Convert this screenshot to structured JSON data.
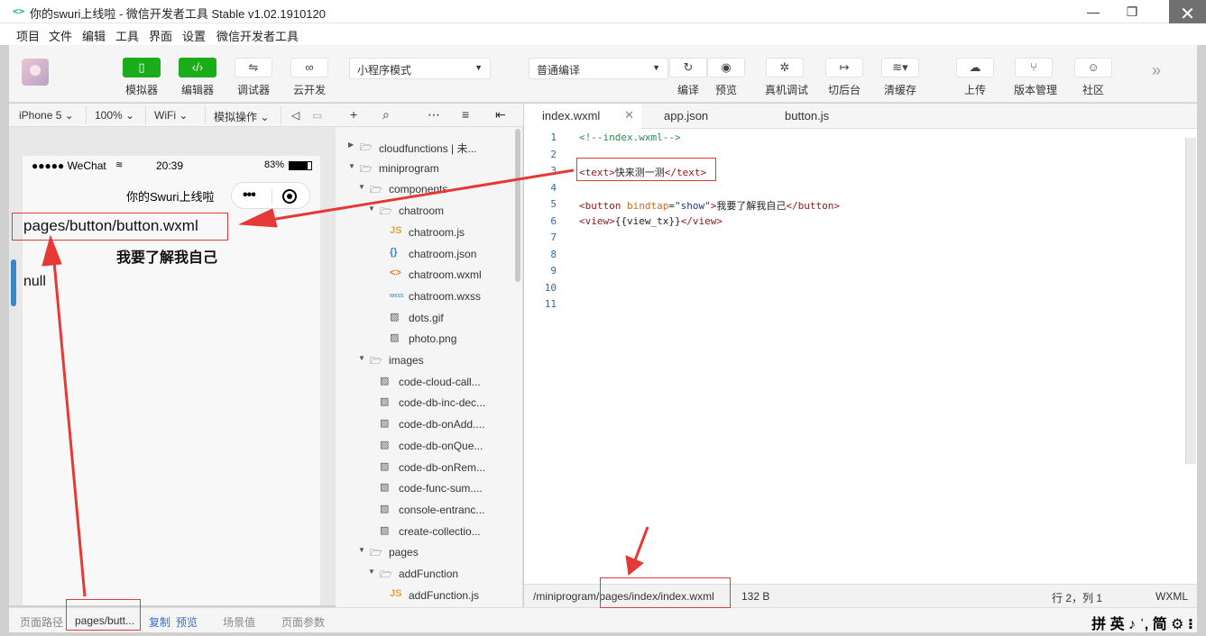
{
  "window": {
    "logo_glyph": "<>",
    "title": "你的swuri上线啦 - 微信开发者工具 Stable v1.02.1910120",
    "minimize_glyph": "—",
    "restore_glyph": "❐",
    "close_glyph": "✕"
  },
  "menu": [
    "项目",
    "文件",
    "编辑",
    "工具",
    "界面",
    "设置",
    "微信开发者工具"
  ],
  "toolbar": {
    "simulator": "模拟器",
    "editor": "编辑器",
    "debugger": "调试器",
    "cloud": "云开发",
    "mode_select": "小程序模式",
    "compile_select": "普通编译",
    "compile": "编译",
    "preview": "预览",
    "real_debug": "真机调试",
    "background": "切后台",
    "clear_cache": "清缓存",
    "upload": "上传",
    "version": "版本管理",
    "community": "社区",
    "more": "»"
  },
  "device_bar": {
    "device": "iPhone 5",
    "zoom": "100%",
    "network": "WiFi",
    "operation": "模拟操作"
  },
  "phone": {
    "carrier": "●●●●● WeChat",
    "time": "20:39",
    "battery": "83%",
    "nav_title": "你的Swuri上线啦",
    "page_path": "pages/button/button.wxml",
    "button_text": "我要了解我自己",
    "view_text": "null"
  },
  "sim_bottom": {
    "path_label": "页面路径",
    "path_value": "pages/butt...",
    "copy": "复制",
    "preview": "预览",
    "scene": "场景值",
    "params": "页面参数"
  },
  "tree": {
    "items": [
      {
        "label": "cloudfunctions | 未...",
        "type": "folder",
        "level": 0,
        "open": false
      },
      {
        "label": "miniprogram",
        "type": "folder",
        "level": 0,
        "open": true
      },
      {
        "label": "components",
        "type": "folder",
        "level": 1,
        "open": true
      },
      {
        "label": "chatroom",
        "type": "folder",
        "level": 2,
        "open": true
      },
      {
        "label": "chatroom.js",
        "type": "js",
        "level": 3
      },
      {
        "label": "chatroom.json",
        "type": "json",
        "level": 3
      },
      {
        "label": "chatroom.wxml",
        "type": "wxml",
        "level": 3
      },
      {
        "label": "chatroom.wxss",
        "type": "wxss",
        "level": 3
      },
      {
        "label": "dots.gif",
        "type": "image",
        "level": 3
      },
      {
        "label": "photo.png",
        "type": "image",
        "level": 3
      },
      {
        "label": "images",
        "type": "folder",
        "level": 1,
        "open": true
      },
      {
        "label": "code-cloud-call...",
        "type": "image",
        "level": 2
      },
      {
        "label": "code-db-inc-dec...",
        "type": "image",
        "level": 2
      },
      {
        "label": "code-db-onAdd....",
        "type": "image",
        "level": 2
      },
      {
        "label": "code-db-onQue...",
        "type": "image",
        "level": 2
      },
      {
        "label": "code-db-onRem...",
        "type": "image",
        "level": 2
      },
      {
        "label": "code-func-sum....",
        "type": "image",
        "level": 2
      },
      {
        "label": "console-entranc...",
        "type": "image",
        "level": 2
      },
      {
        "label": "create-collectio...",
        "type": "image",
        "level": 2
      },
      {
        "label": "pages",
        "type": "folder",
        "level": 1,
        "open": true
      },
      {
        "label": "addFunction",
        "type": "folder",
        "level": 2,
        "open": true
      },
      {
        "label": "addFunction.js",
        "type": "js",
        "level": 3
      }
    ]
  },
  "tabs": [
    {
      "label": "index.wxml",
      "active": true
    },
    {
      "label": "app.json",
      "active": false
    },
    {
      "label": "button.js",
      "active": false
    }
  ],
  "editor": {
    "line_numbers": [
      "1",
      "2",
      "3",
      "4",
      "5",
      "6",
      "7",
      "8",
      "9",
      "10",
      "11"
    ],
    "status_path": "/miniprogram/pages/index/index.wxml",
    "status_size": "132 B",
    "status_pos": "行 2，列 1",
    "status_lang": "WXML"
  },
  "ime": "拼 英 ♪ ˈ, 简 ⚙ ⁝",
  "colors": {
    "accent_green": "#1aad19",
    "annotation_red": "#e53935"
  }
}
